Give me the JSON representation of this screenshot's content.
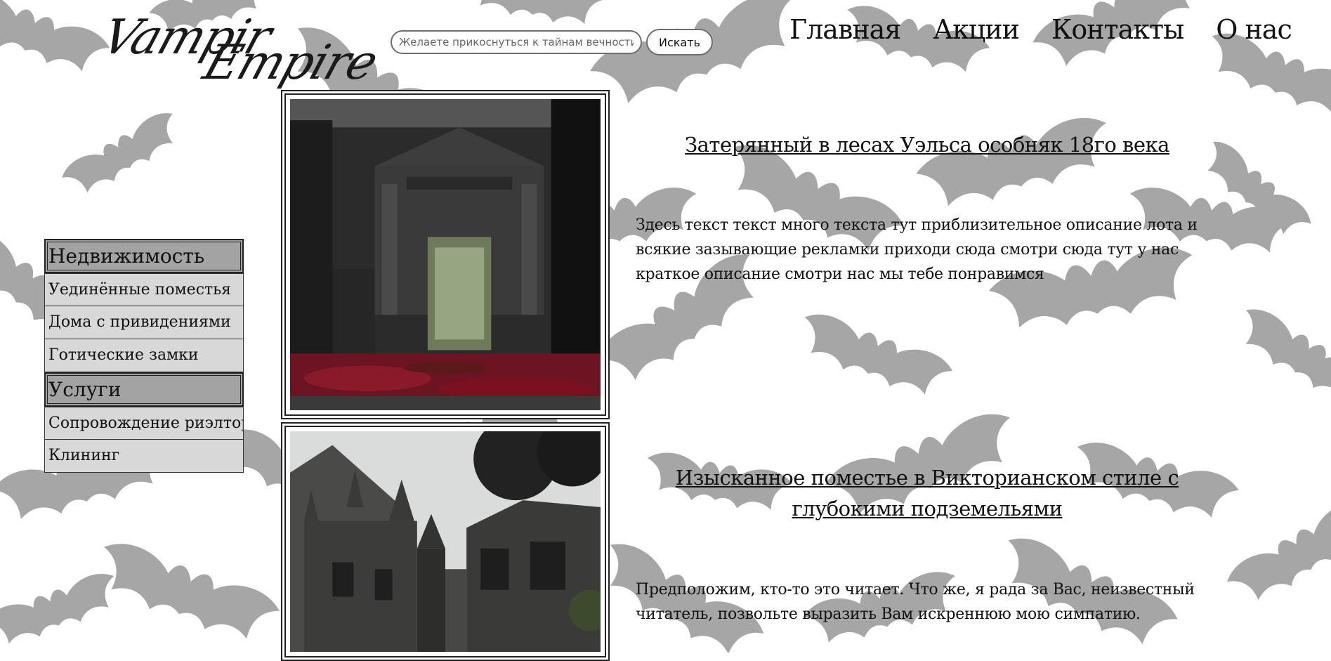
{
  "brand": {
    "logo_line1": "Vampir",
    "logo_line2": "Empire"
  },
  "search": {
    "placeholder": "Желаете прикоснуться к тайнам вечности?",
    "button_label": "Искать",
    "icon": "search-button-text"
  },
  "nav": {
    "items": [
      {
        "label": "Главная"
      },
      {
        "label": "Акции"
      },
      {
        "label": "Контакты"
      },
      {
        "label": "О нас"
      }
    ]
  },
  "sidebar": {
    "sections": [
      {
        "title": "Недвижимость",
        "items": [
          "Уединённые поместья",
          "Дома с привидениями",
          "Готические замки"
        ]
      },
      {
        "title": "Услуги",
        "items": [
          "Сопровождение риэлтора",
          "Клининг"
        ]
      }
    ]
  },
  "listings": [
    {
      "title": "Затерянный в лесах Уэльса особняк 18го века",
      "description": "Здесь текст текст много текста тут приблизительное описание лота и всякие зазывающие рекламки приходи сюда смотри сюда тут у нас краткое описание смотри нас мы тебе понравимся"
    },
    {
      "title": "Изысканное поместье в Викторианском стиле с глубокими подземельями",
      "description": "Предположим, кто-то это читает. Что же, я рада за Вас, неизвестный читатель, позвольте выразить Вам искреннюю мою симпатию."
    }
  ],
  "colors": {
    "bat_silhouette": "#a6a6a6",
    "menu_header": "#a3a3a3",
    "menu_item": "#d8d8d8",
    "leaves": "#7a1020"
  }
}
